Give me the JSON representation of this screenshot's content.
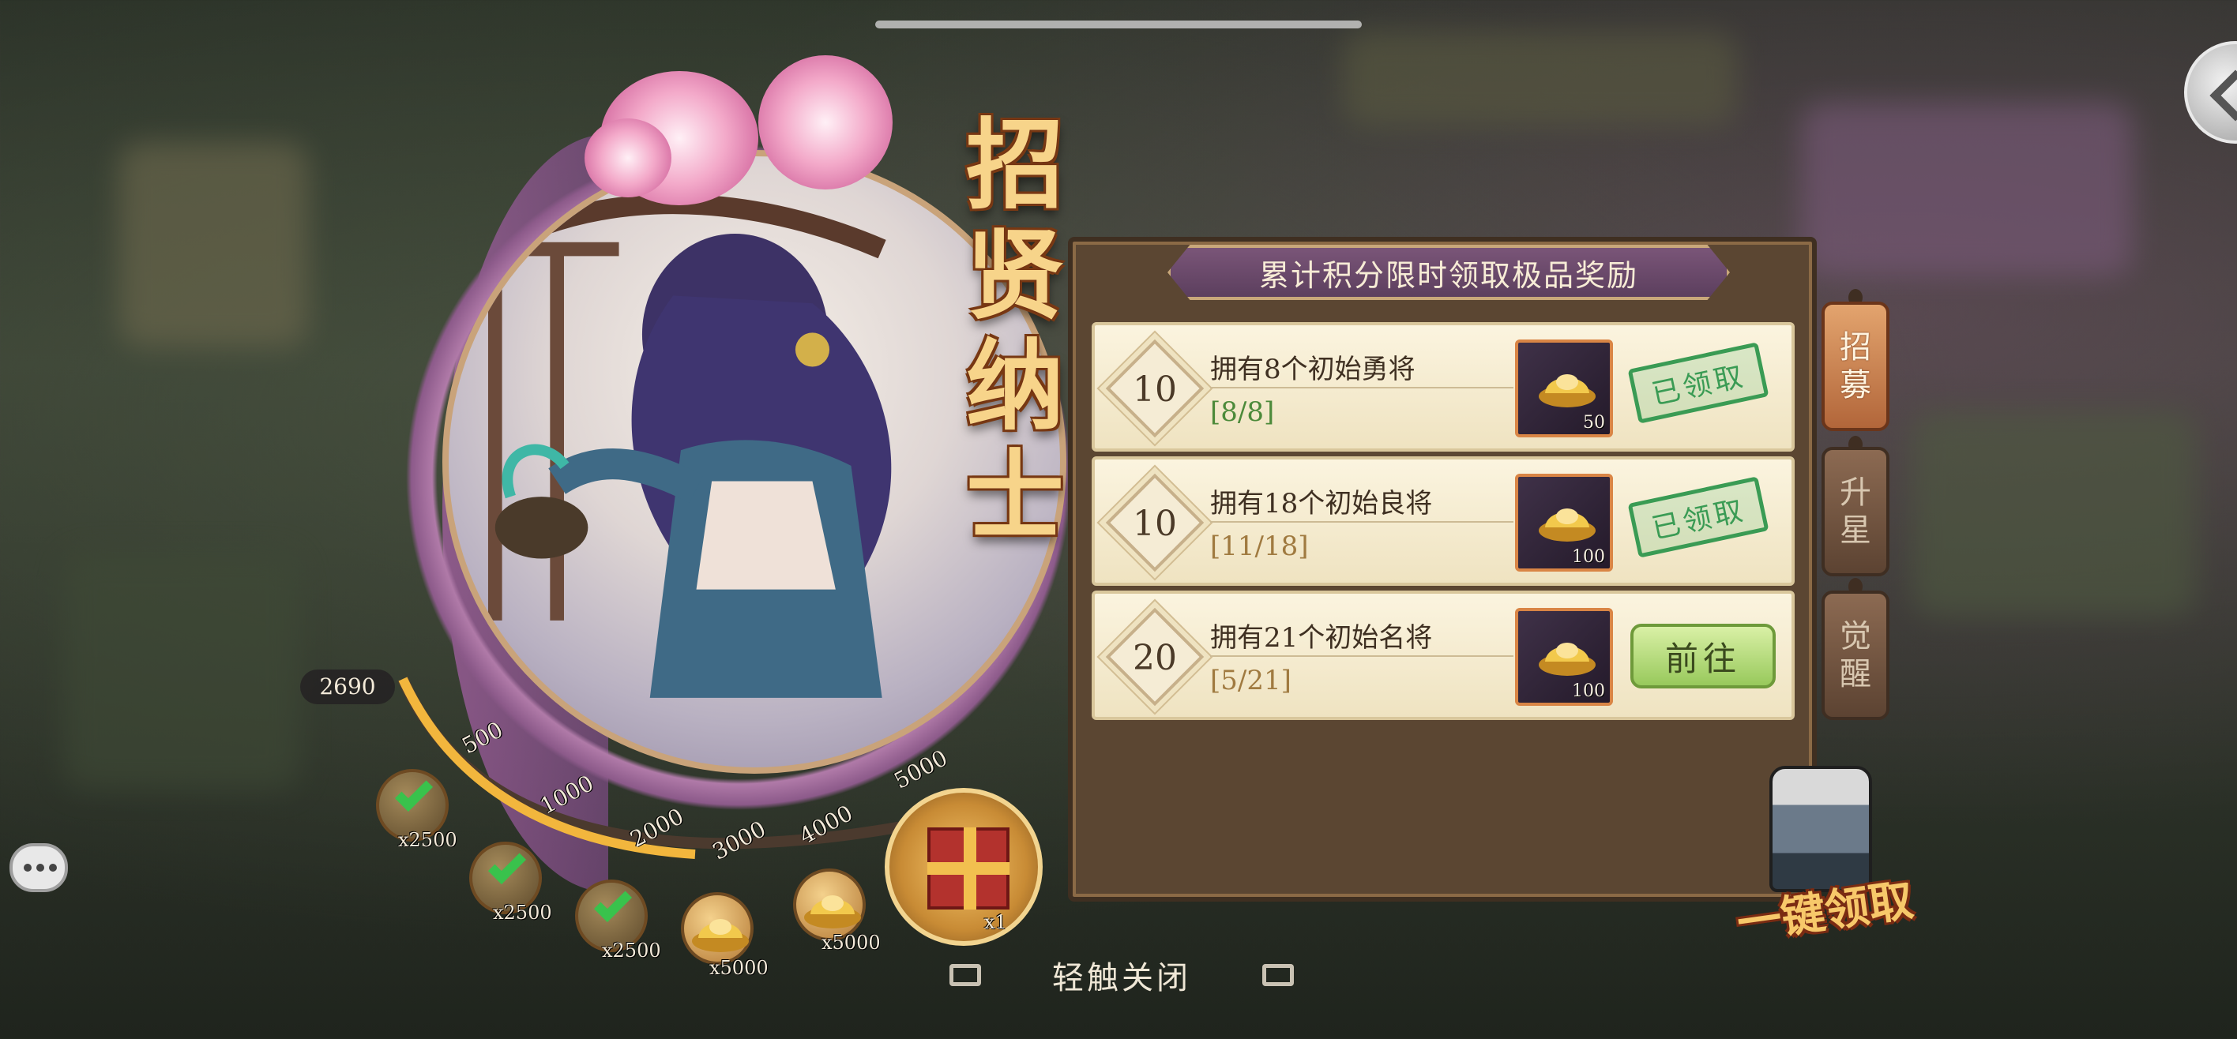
{
  "title_chars": [
    "招",
    "贤",
    "纳",
    "士"
  ],
  "panel": {
    "header": "累计积分限时领取极品奖励",
    "tasks": [
      {
        "points": "10",
        "title": "拥有8个初始勇将",
        "progress": "[8/8]",
        "progress_color": "#4c8a3a",
        "reward_count": "50",
        "status": "已领取"
      },
      {
        "points": "10",
        "title": "拥有18个初始良将",
        "progress": "[11/18]",
        "progress_color": "#a07a40",
        "reward_count": "100",
        "status": "已领取"
      },
      {
        "points": "20",
        "title": "拥有21个初始名将",
        "progress": "[5/21]",
        "progress_color": "#a07a40",
        "reward_count": "100",
        "action": "前往"
      }
    ]
  },
  "side_tabs": [
    {
      "label_top": "招",
      "label_bottom": "募",
      "active": true
    },
    {
      "label_top": "升",
      "label_bottom": "星",
      "active": false
    },
    {
      "label_top": "觉",
      "label_bottom": "醒",
      "active": false
    }
  ],
  "score": {
    "value": "2690"
  },
  "milestones": {
    "labels": [
      "500",
      "1000",
      "2000",
      "3000",
      "4000",
      "5000"
    ],
    "rewards": [
      {
        "count": "x2500",
        "claimed": true
      },
      {
        "count": "x2500",
        "claimed": true
      },
      {
        "count": "x2500",
        "claimed": true
      },
      {
        "count": "x5000",
        "claimed": false
      },
      {
        "count": "x5000",
        "claimed": false
      },
      {
        "count": "x1",
        "claimed": false,
        "final": true
      }
    ]
  },
  "claim_all_label": "一键领取",
  "tap_close_label": "轻触关闭",
  "icons": {
    "back": "chevron-left-icon",
    "chat": "chat-bubble-icon",
    "ingot": "gold-ingot-icon",
    "check": "check-icon",
    "gift": "gift-box-icon"
  }
}
